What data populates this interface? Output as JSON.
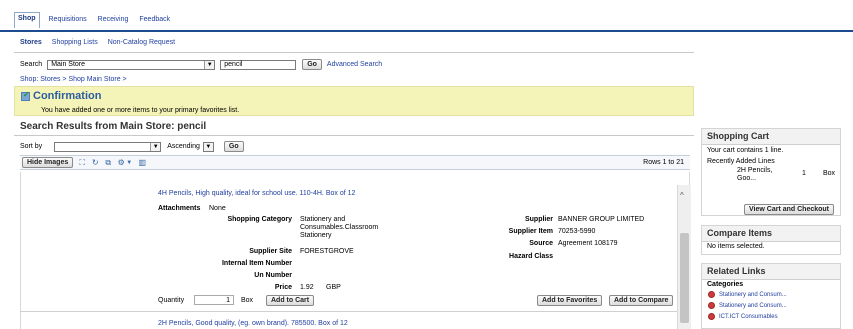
{
  "tabs": [
    "Shop",
    "Requisitions",
    "Receiving",
    "Feedback"
  ],
  "subnav": [
    "Stores",
    "Shopping Lists",
    "Non-Catalog Request"
  ],
  "search": {
    "label": "Search",
    "store": "Main Store",
    "query": "pencil",
    "go_label": "Go",
    "advanced_label": "Advanced Search"
  },
  "breadcrumb": "Shop: Stores  >  Shop Main Store  >",
  "confirmation": {
    "title": "Confirmation",
    "message": "You have added one or more items to your primary favorites list."
  },
  "results_title": "Search Results from Main Store: pencil",
  "sort": {
    "label": "Sort by",
    "field": "",
    "direction": "Ascending",
    "go_label": "Go"
  },
  "toolbar": {
    "hide_images_label": "Hide Images",
    "rows_text": "Rows 1 to 21"
  },
  "items": [
    {
      "title": "4H Pencils, High quality, ideal for school use. 110-4H. Box of 12",
      "attachments_label": "Attachments",
      "attachments_value": "None",
      "shopping_category_label": "Shopping Category",
      "shopping_category_value": "Stationery and Consumables.Classroom Stationery",
      "supplier_site_label": "Supplier Site",
      "supplier_site_value": "FORESTGROVE",
      "internal_item_label": "Internal Item Number",
      "un_number_label": "Un Number",
      "price_label": "Price",
      "price_value": "1.92",
      "price_currency": "GBP",
      "quantity_label": "Quantity",
      "quantity_value": "1",
      "uom": "Box",
      "add_to_cart_label": "Add to Cart",
      "supplier_label": "Supplier",
      "supplier_value": "BANNER GROUP LIMITED",
      "supplier_item_label": "Supplier Item",
      "supplier_item_value": "70253-5990",
      "source_label": "Source",
      "source_value": "Agreement 108179",
      "hazard_label": "Hazard Class",
      "add_to_favorites_label": "Add to Favorites",
      "add_to_compare_label": "Add to Compare"
    },
    {
      "title": "2H Pencils, Good quality, (eg. own brand). 785500. Box of 12"
    }
  ],
  "shopping_cart": {
    "title": "Shopping Cart",
    "contains": "Your cart contains 1 line.",
    "recent_label": "Recently Added Lines",
    "recent_item_name": "2H Pencils, Goo...",
    "recent_item_qty": "1",
    "recent_item_uom": "Box",
    "view_label": "View Cart and Checkout"
  },
  "compare": {
    "title": "Compare Items",
    "text": "No items selected."
  },
  "related_links": {
    "title": "Related Links",
    "categories_label": "Categories",
    "items": [
      "Stationery and Consum...",
      "Stationery and Consum...",
      "ICT.ICT Consumables"
    ]
  }
}
